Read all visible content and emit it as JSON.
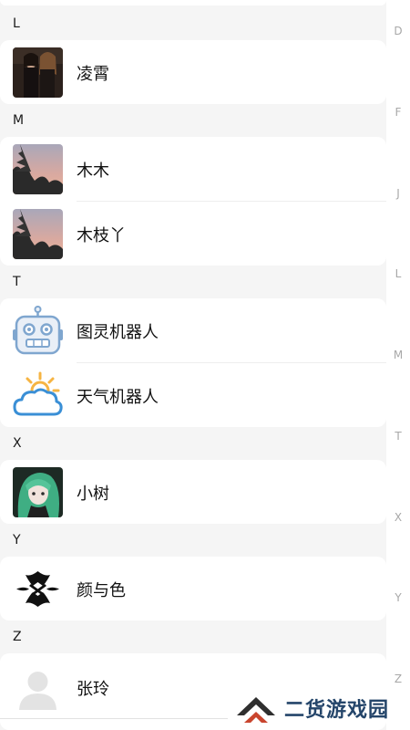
{
  "sections": [
    {
      "letter": "L",
      "contacts": [
        {
          "name": "凌霄",
          "avatar": "photo-band"
        }
      ]
    },
    {
      "letter": "M",
      "contacts": [
        {
          "name": "木木",
          "avatar": "sunset-tree"
        },
        {
          "name": "木枝丫",
          "avatar": "sunset-tree"
        }
      ]
    },
    {
      "letter": "T",
      "contacts": [
        {
          "name": "图灵机器人",
          "avatar": "robot-icon"
        },
        {
          "name": "天气机器人",
          "avatar": "weather-cloud-sun-icon"
        }
      ]
    },
    {
      "letter": "X",
      "contacts": [
        {
          "name": "小树",
          "avatar": "anime-green-hair"
        }
      ]
    },
    {
      "letter": "Y",
      "contacts": [
        {
          "name": "颜与色",
          "avatar": "tribal-logo"
        }
      ]
    },
    {
      "letter": "Z",
      "contacts": [
        {
          "name": "张玲",
          "avatar": "default-person-icon"
        }
      ]
    }
  ],
  "index_bar": [
    "D",
    "F",
    "J",
    "L",
    "M",
    "T",
    "X",
    "Y",
    "Z"
  ],
  "watermark": {
    "text": "二货游戏园"
  },
  "colors": {
    "background": "#f5f5f5",
    "card": "#ffffff",
    "index_text": "#a8a8a8",
    "robot": "#7fa6cf",
    "weather": "#3a8fd6",
    "sun": "#f6b443"
  }
}
